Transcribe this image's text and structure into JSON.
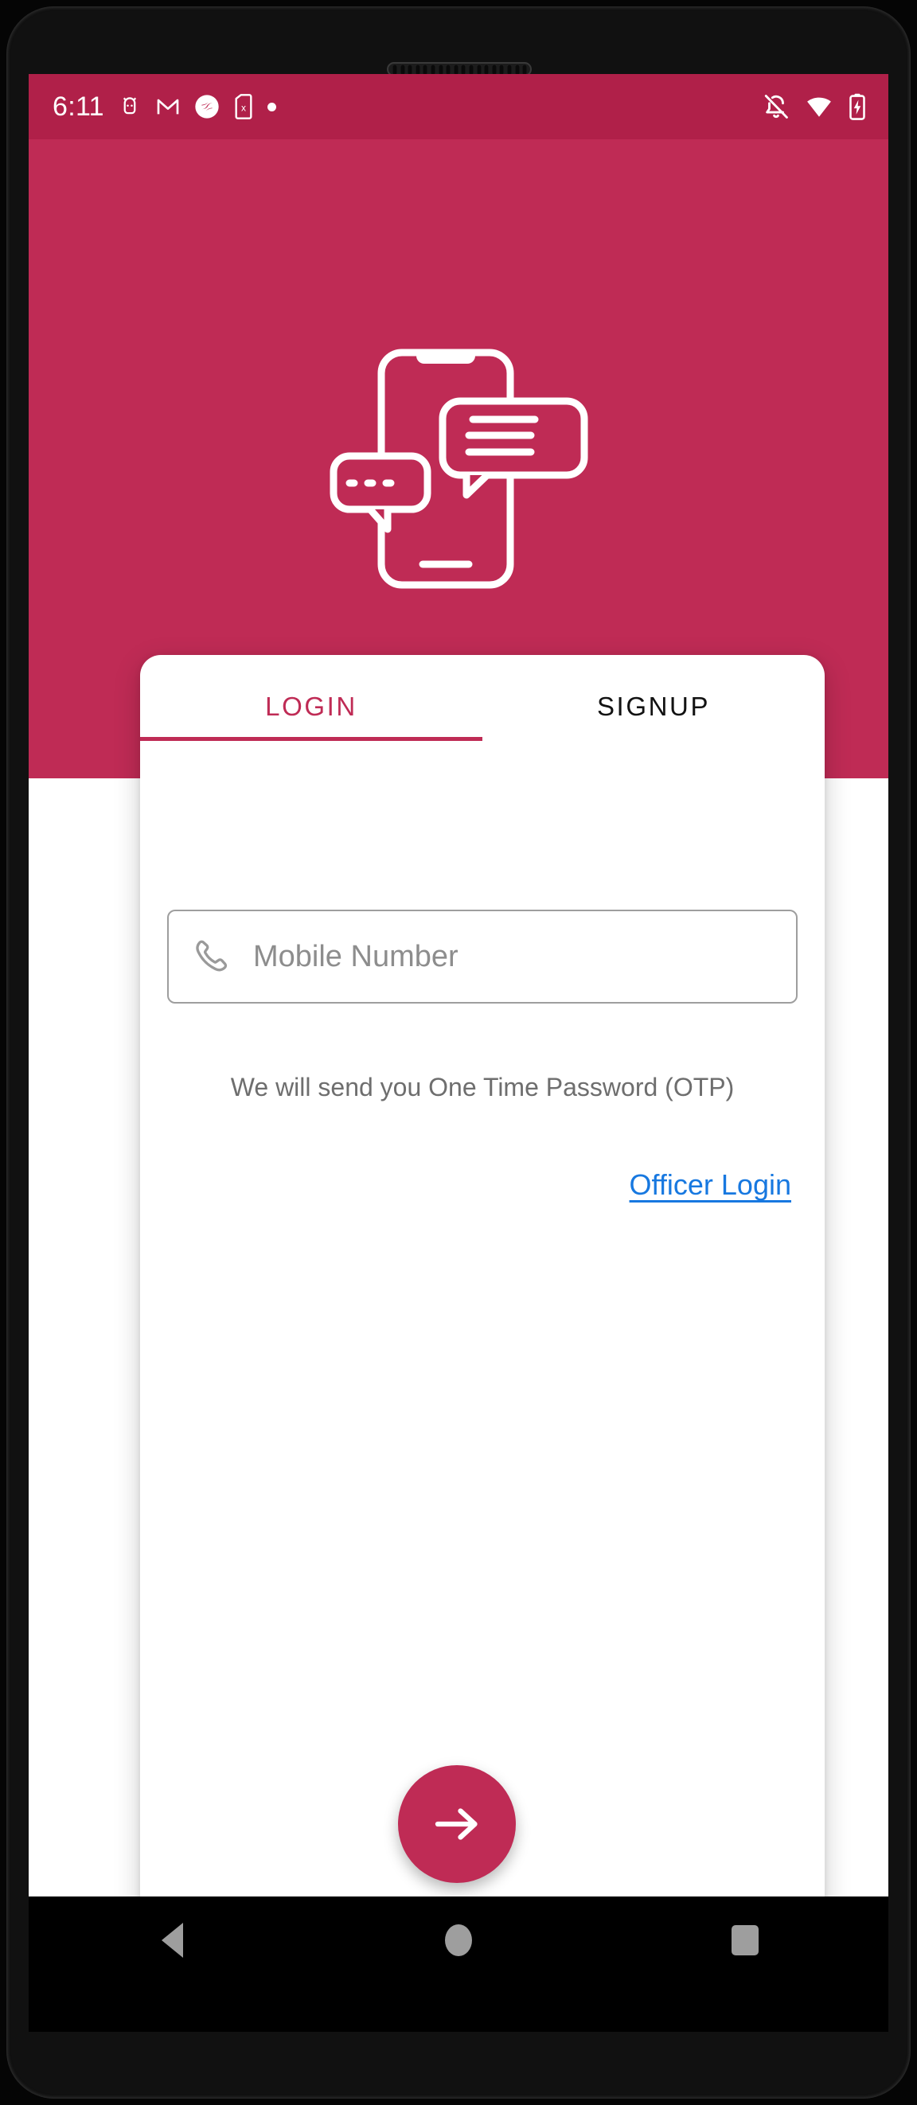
{
  "status_bar": {
    "clock": "6:11",
    "left_icons": [
      {
        "name": "android-debug-icon",
        "label": "USB debugging"
      },
      {
        "name": "gmail-icon",
        "label": "Gmail"
      },
      {
        "name": "app-notification-icon",
        "label": "App notification"
      },
      {
        "name": "sim-missing-icon",
        "label": "No SIM card"
      },
      {
        "name": "notification-dot-icon",
        "label": "More notifications"
      }
    ],
    "right_icons": [
      {
        "name": "bell-off-icon",
        "label": "Silent mode"
      },
      {
        "name": "wifi-icon",
        "label": "Wi-Fi connected"
      },
      {
        "name": "battery-charging-icon",
        "label": "Battery charging"
      }
    ]
  },
  "hero": {
    "illustration_name": "phone-chat-illustration",
    "background_color": "#BF2B55"
  },
  "card": {
    "tabs": [
      {
        "label": "LOGIN",
        "active": true,
        "name": "tab-login"
      },
      {
        "label": "SIGNUP",
        "active": false,
        "name": "tab-signup"
      }
    ],
    "mobile_input": {
      "value": "",
      "placeholder": "Mobile Number",
      "icon": "phone-call-icon"
    },
    "otp_note": "We will send you One Time Password (OTP)",
    "officer_login_link": "Officer Login"
  },
  "fab": {
    "label": "",
    "icon": "arrow-right-icon",
    "color": "#BF2B55"
  },
  "nav_bar": {
    "buttons": [
      {
        "name": "nav-back-button",
        "label": "Back"
      },
      {
        "name": "nav-home-button",
        "label": "Home"
      },
      {
        "name": "nav-recents-button",
        "label": "Recents"
      }
    ]
  },
  "colors": {
    "brand_crimson": "#BF2B55",
    "status_bar_crimson": "#B02049",
    "link_blue": "#1778E0",
    "placeholder_gray": "#8d8d8d",
    "note_gray": "#6e6e6e"
  }
}
